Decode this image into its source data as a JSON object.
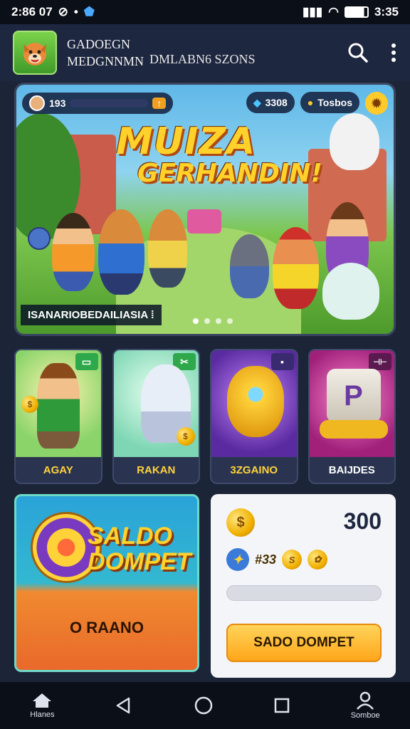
{
  "status_bar": {
    "time_left": "2:86 07",
    "time_right": "3:35"
  },
  "app_bar": {
    "title_line1": "GADOEGN",
    "title_line2": "MEDGNNMN",
    "subtitle": "DMLABN6 SZONS"
  },
  "hero": {
    "hud_left": "193",
    "hud_mid": "3308",
    "hud_right": "Tosbos",
    "title_line1": "MUIZA",
    "title_line2": "GERHANDIN!",
    "caption": "ISANARIOBEDAILIASIA",
    "slides": 4,
    "active_slide": 0
  },
  "cards": [
    {
      "label": "AGAY",
      "badge": "▭"
    },
    {
      "label": "RAKAN",
      "badge": "✂"
    },
    {
      "label": "3ZGAINO",
      "badge": "▪"
    },
    {
      "label": "BAIJDES",
      "badge": "⊣⊢"
    }
  ],
  "promo": {
    "title_line1": "SALDO",
    "title_line2": "DOMPET",
    "button": "O RAANO"
  },
  "wallet": {
    "amount": "300",
    "coin_text": "#33",
    "progress": 0,
    "button": "SADO DOMPET"
  },
  "nav": {
    "home_label": "Hlanes",
    "profile_label": "Somboe"
  },
  "colors": {
    "accent_yellow": "#ffd12a",
    "bg": "#1c2438",
    "card_bg": "#2a3450"
  }
}
